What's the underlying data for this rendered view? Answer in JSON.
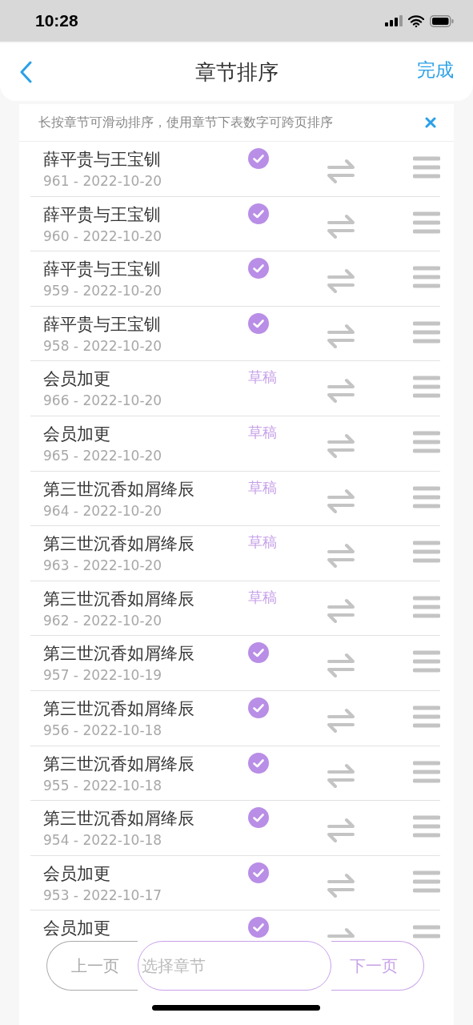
{
  "status_bar": {
    "time": "10:28"
  },
  "header": {
    "title": "章节排序",
    "done": "完成"
  },
  "notice": {
    "text": "长按章节可滑动排序，使用章节下表数字可跨页排序"
  },
  "chapters": [
    {
      "title": "薛平贵与王宝钏",
      "meta": "961 - 2022-10-20",
      "kind": "check"
    },
    {
      "title": "薛平贵与王宝钏",
      "meta": "960 - 2022-10-20",
      "kind": "check"
    },
    {
      "title": "薛平贵与王宝钏",
      "meta": "959 - 2022-10-20",
      "kind": "check"
    },
    {
      "title": "薛平贵与王宝钏",
      "meta": "958 - 2022-10-20",
      "kind": "check"
    },
    {
      "title": "会员加更",
      "meta": "966 - 2022-10-20",
      "kind": "draft",
      "badge": "草稿"
    },
    {
      "title": "会员加更",
      "meta": "965 - 2022-10-20",
      "kind": "draft",
      "badge": "草稿"
    },
    {
      "title": "第三世沉香如屑绛辰",
      "meta": "964 - 2022-10-20",
      "kind": "draft",
      "badge": "草稿"
    },
    {
      "title": "第三世沉香如屑绛辰",
      "meta": "963 - 2022-10-20",
      "kind": "draft",
      "badge": "草稿"
    },
    {
      "title": "第三世沉香如屑绛辰",
      "meta": "962 - 2022-10-20",
      "kind": "draft",
      "badge": "草稿"
    },
    {
      "title": "第三世沉香如屑绛辰",
      "meta": "957 - 2022-10-19",
      "kind": "check"
    },
    {
      "title": "第三世沉香如屑绛辰",
      "meta": "956 - 2022-10-18",
      "kind": "check"
    },
    {
      "title": "第三世沉香如屑绛辰",
      "meta": "955 - 2022-10-18",
      "kind": "check"
    },
    {
      "title": "第三世沉香如屑绛辰",
      "meta": "954 - 2022-10-18",
      "kind": "check"
    },
    {
      "title": "会员加更",
      "meta": "953 - 2022-10-17",
      "kind": "check"
    },
    {
      "title": "会员加更",
      "kind": "check"
    }
  ],
  "pager": {
    "prev": "上一页",
    "select_placeholder": "选择章节",
    "next": "下一页"
  }
}
